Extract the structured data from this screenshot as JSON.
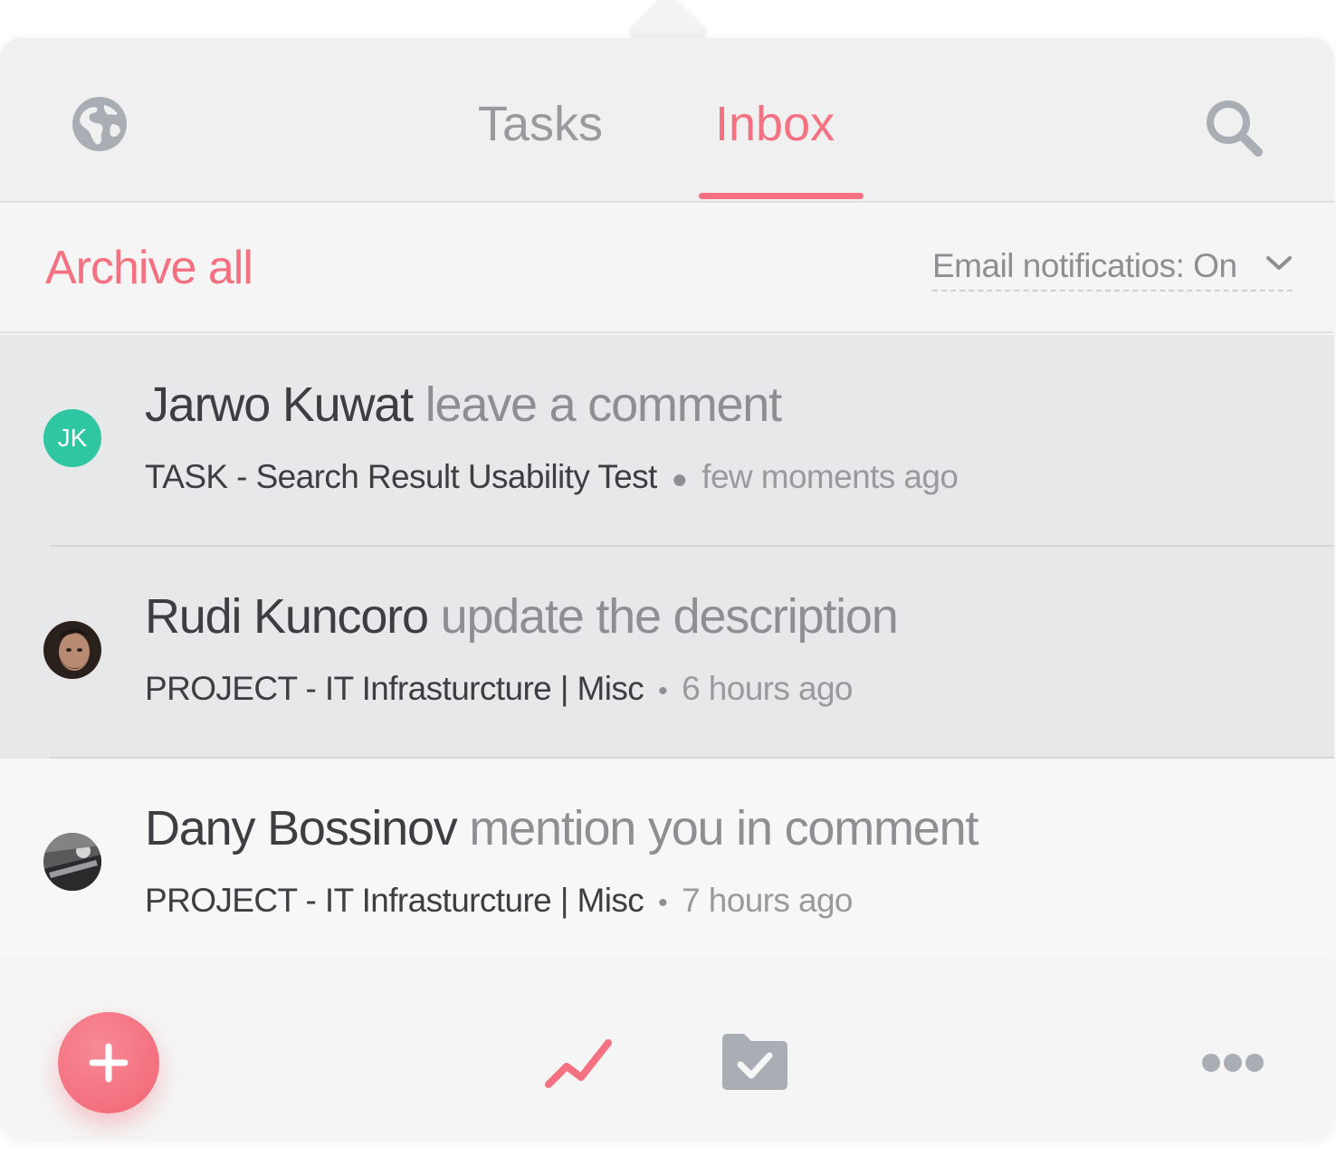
{
  "header": {
    "tabs": [
      {
        "label": "Tasks",
        "active": false
      },
      {
        "label": "Inbox",
        "active": true
      }
    ],
    "left_icon": "globe-icon",
    "right_icon": "search-icon"
  },
  "toolbar": {
    "archive_all_label": "Archive all",
    "email_notifications_label": "Email notificatios: On"
  },
  "notifications": [
    {
      "name": "Jarwo Kuwat",
      "action": "leave a comment",
      "context": "TASK - Search Result Usability Test",
      "time": "few moments ago",
      "avatar_initials": "JK",
      "highlighted": true
    },
    {
      "name": "Rudi Kuncoro",
      "action": "update the description",
      "context": "PROJECT - IT Infrasturcture | Misc",
      "time": "6 hours ago",
      "avatar_initials": "",
      "highlighted": true
    },
    {
      "name": "Dany Bossinov",
      "action": "mention you in comment",
      "context": "PROJECT - IT Infrasturcture | Misc",
      "time": "7 hours ago",
      "avatar_initials": "",
      "highlighted": false
    }
  ],
  "bottom_bar": {
    "icons": [
      "plus-icon",
      "activity-icon",
      "folder-check-icon",
      "more-icon"
    ]
  },
  "colors": {
    "accent": "#f47181",
    "avatar_green": "#2ec7a1",
    "text_dark": "#3e3e42",
    "text_muted": "#8e8e93",
    "icon_gray": "#a9adb4"
  }
}
